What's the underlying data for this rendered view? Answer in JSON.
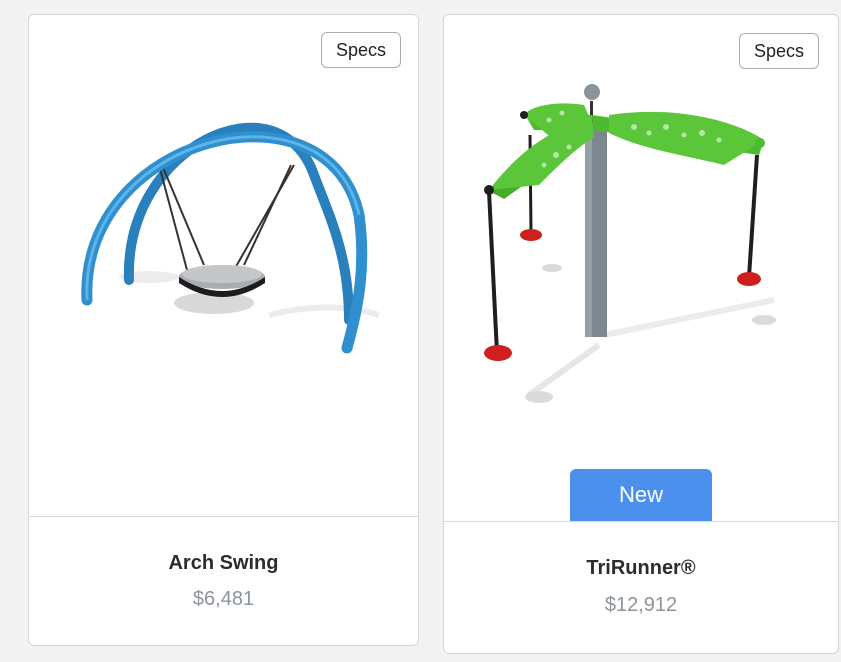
{
  "products": [
    {
      "name": "Arch Swing",
      "price": "$6,481",
      "specs_label": "Specs",
      "image": "arch-swing-playground-equipment"
    },
    {
      "name": "TriRunner®",
      "price": "$12,912",
      "specs_label": "Specs",
      "badge": "New",
      "image": "trirunner-playground-equipment"
    }
  ],
  "colors": {
    "arch_blue": "#2f8fcf",
    "green": "#4dbb2e",
    "badge_blue": "#4a90ec",
    "price_gray": "#8c939b",
    "seat_red": "#cf1f1f"
  }
}
